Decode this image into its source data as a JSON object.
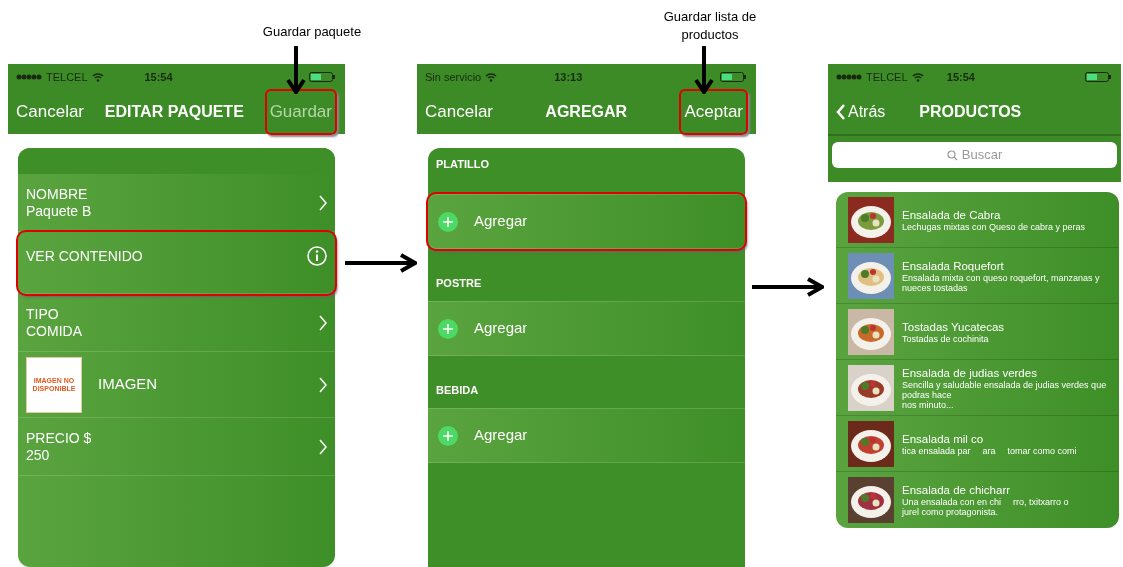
{
  "annotations": [
    {
      "text": "Guardar paquete"
    },
    {
      "text": "Guardar lista de productos"
    }
  ],
  "screens": [
    {
      "kind": "edit",
      "status": {
        "carrier": "TELCEL",
        "signal": true,
        "time": "15:54"
      },
      "nav": {
        "left": "Cancelar",
        "title": "EDITAR PAQUETE",
        "right": "Guardar",
        "right_disabled": true,
        "right_highlighted": true
      },
      "rows": [
        {
          "kind": "field",
          "label": "NOMBRE",
          "value": "Paquete B",
          "highlighted": false
        },
        {
          "kind": "action",
          "label": "VER CONTENIDO",
          "highlighted": true
        },
        {
          "kind": "field",
          "label": "TIPO",
          "value": "COMIDA",
          "highlighted": false
        },
        {
          "label": "IMAGEN",
          "placeholder_text": "IMAGEN NO DISPONIBLE",
          "highlighted": false
        },
        {
          "kind": "field",
          "label": "PRECIO $",
          "value": "250",
          "highlighted": false
        }
      ]
    },
    {
      "kind": "add",
      "status": {
        "carrier": "Sin servicio",
        "signal": false,
        "time": "13:13"
      },
      "nav": {
        "left": "Cancelar",
        "title": "AGREGAR",
        "right": "Aceptar",
        "right_disabled": false,
        "right_highlighted": true
      },
      "sections": [
        {
          "header": "PLATILLO",
          "add_label": "Agregar",
          "highlighted": true
        },
        {
          "header": "POSTRE",
          "add_label": "Agregar",
          "highlighted": false
        },
        {
          "header": "BEBIDA",
          "add_label": "Agregar",
          "highlighted": false
        }
      ]
    },
    {
      "kind": "list",
      "status": {
        "carrier": "TELCEL",
        "signal": true,
        "time": "15:54"
      },
      "nav": {
        "left": "Atrás",
        "title": "PRODUCTOS"
      },
      "search": {
        "placeholder": "Buscar"
      },
      "products": [
        {
          "title": "Ensalada de Cabra",
          "description": [
            "Lechugas mixtas con Queso de cabra y peras"
          ]
        },
        {
          "title": "Ensalada Roquefort",
          "description": [
            "Ensalada mixta con queso roquefort, manzanas y nueces tostadas"
          ]
        },
        {
          "title": "Tostadas Yucatecas",
          "description": [
            "Tostadas de cochinita"
          ]
        },
        {
          "title": "Ensalada de judias verdes",
          "description": [
            "Sencilla y saludable ensalada de judias verdes que podras hace",
            "nos minuto..."
          ]
        },
        {
          "title": "Ensalada mil co",
          "description": [
            "tica ensalada par",
            "ara",
            "tomar como comi"
          ]
        },
        {
          "title": "Ensalada de chicharr",
          "description": [
            "Una ensalada con en chi",
            "rro, txitxarro o",
            "jurel como protagonista."
          ]
        }
      ]
    }
  ]
}
